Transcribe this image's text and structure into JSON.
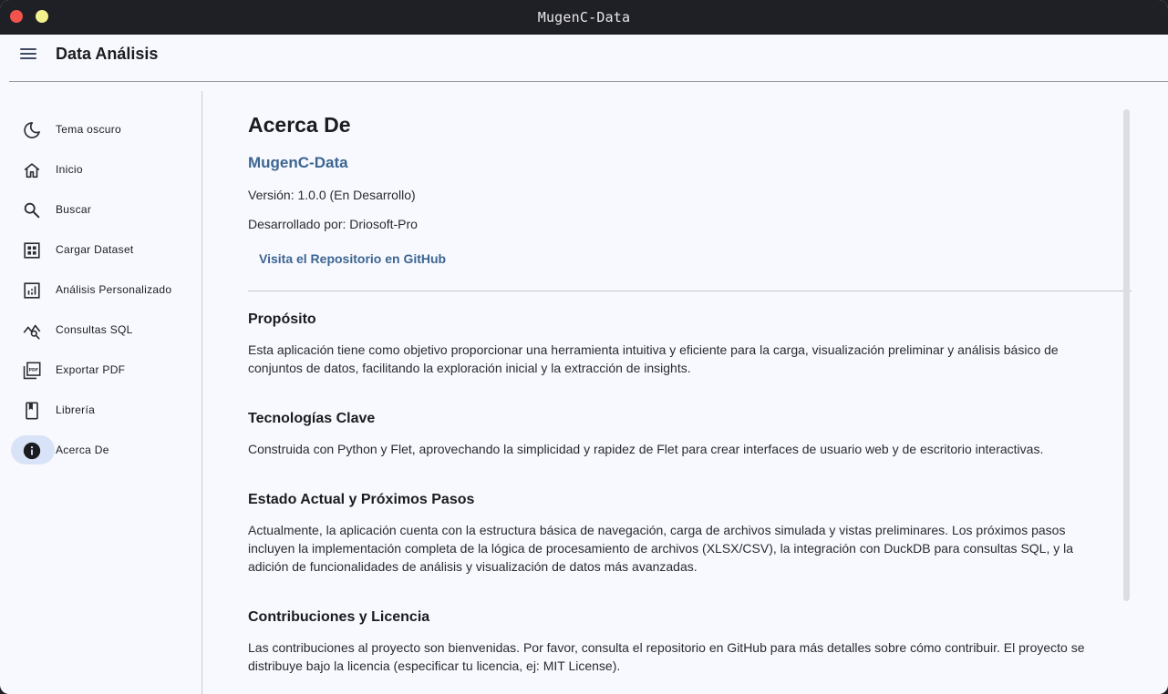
{
  "window": {
    "title": "MugenC-Data"
  },
  "appbar": {
    "title": "Data Análisis",
    "menu_icon": "menu-icon"
  },
  "sidebar": {
    "items": [
      {
        "label": "Tema oscuro",
        "icon": "dark-mode-icon"
      },
      {
        "label": "Inicio",
        "icon": "home-icon"
      },
      {
        "label": "Buscar",
        "icon": "search-icon"
      },
      {
        "label": "Cargar Dataset",
        "icon": "dataset-icon"
      },
      {
        "label": "Análisis Personalizado",
        "icon": "analytics-icon"
      },
      {
        "label": "Consultas SQL",
        "icon": "query-stats-icon"
      },
      {
        "label": "Exportar PDF",
        "icon": "pdf-icon"
      },
      {
        "label": "Librería",
        "icon": "book-icon"
      },
      {
        "label": "Acerca De",
        "icon": "info-icon",
        "active": true
      }
    ]
  },
  "main": {
    "title": "Acerca De",
    "app_name": "MugenC-Data",
    "version": "Versión: 1.0.0 (En Desarrollo)",
    "developer": "Desarrollado por: Driosoft-Pro",
    "repo_link": "Visita el Repositorio en GitHub",
    "sections": [
      {
        "title": "Propósito",
        "body": "Esta aplicación tiene como objetivo proporcionar una herramienta intuitiva y eficiente para la carga, visualización preliminar y análisis básico de conjuntos de datos, facilitando la exploración inicial y la extracción de insights."
      },
      {
        "title": "Tecnologías Clave",
        "body": "Construida con Python y Flet, aprovechando la simplicidad y rapidez de Flet para crear interfaces de usuario web y de escritorio interactivas."
      },
      {
        "title": "Estado Actual y Próximos Pasos",
        "body": "Actualmente, la aplicación cuenta con la estructura básica de navegación, carga de archivos simulada y vistas preliminares. Los próximos pasos incluyen la implementación completa de la lógica de procesamiento de archivos (XLSX/CSV), la integración con DuckDB para consultas SQL, y la adición de funcionalidades de análisis y visualización de datos más avanzadas."
      },
      {
        "title": "Contribuciones y Licencia",
        "body": "Las contribuciones al proyecto son bienvenidas. Por favor, consulta el repositorio en GitHub para más detalles sobre cómo contribuir. El proyecto se distribuye bajo la licencia (especificar tu licencia, ej: MIT License)."
      }
    ]
  },
  "colors": {
    "accent": "#3c6592",
    "active_pill": "#d9e3f8",
    "titlebar": "#1f1f26",
    "background": "#f8f9fe"
  }
}
